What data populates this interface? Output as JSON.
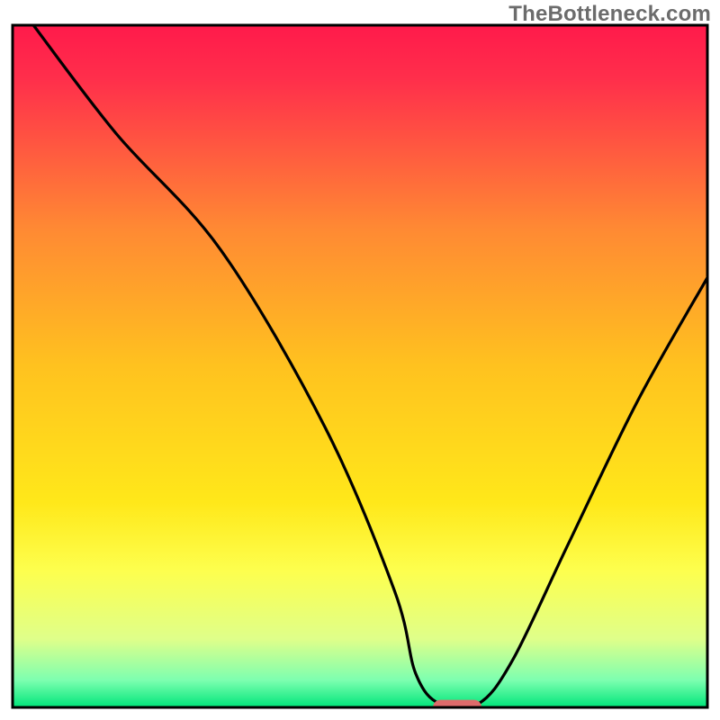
{
  "watermark": "TheBottleneck.com",
  "chart_data": {
    "type": "line",
    "title": "",
    "xlabel": "",
    "ylabel": "",
    "xlim": [
      0,
      100
    ],
    "ylim": [
      0,
      100
    ],
    "background": {
      "type": "vertical-gradient",
      "stops": [
        {
          "offset": 0.0,
          "color": "#ff1a4b"
        },
        {
          "offset": 0.08,
          "color": "#ff2f4b"
        },
        {
          "offset": 0.3,
          "color": "#ff8a33"
        },
        {
          "offset": 0.5,
          "color": "#ffc21f"
        },
        {
          "offset": 0.7,
          "color": "#ffe81a"
        },
        {
          "offset": 0.8,
          "color": "#fdff4e"
        },
        {
          "offset": 0.9,
          "color": "#dfff8a"
        },
        {
          "offset": 0.96,
          "color": "#7dffb0"
        },
        {
          "offset": 1.0,
          "color": "#00e57a"
        }
      ]
    },
    "series": [
      {
        "name": "bottleneck-curve",
        "color": "#000000",
        "x": [
          3,
          15,
          30,
          45,
          55,
          58,
          61.5,
          67,
          72,
          80,
          90,
          100
        ],
        "y": [
          100,
          84,
          67,
          41,
          17,
          5,
          0.5,
          0.5,
          7,
          24,
          45,
          63
        ]
      }
    ],
    "marker": {
      "shape": "pill",
      "color": "#dd6b6b",
      "x": 64,
      "y": 0,
      "width": 7,
      "height": 2.2
    },
    "border": {
      "color": "#000000",
      "width": 3
    }
  }
}
